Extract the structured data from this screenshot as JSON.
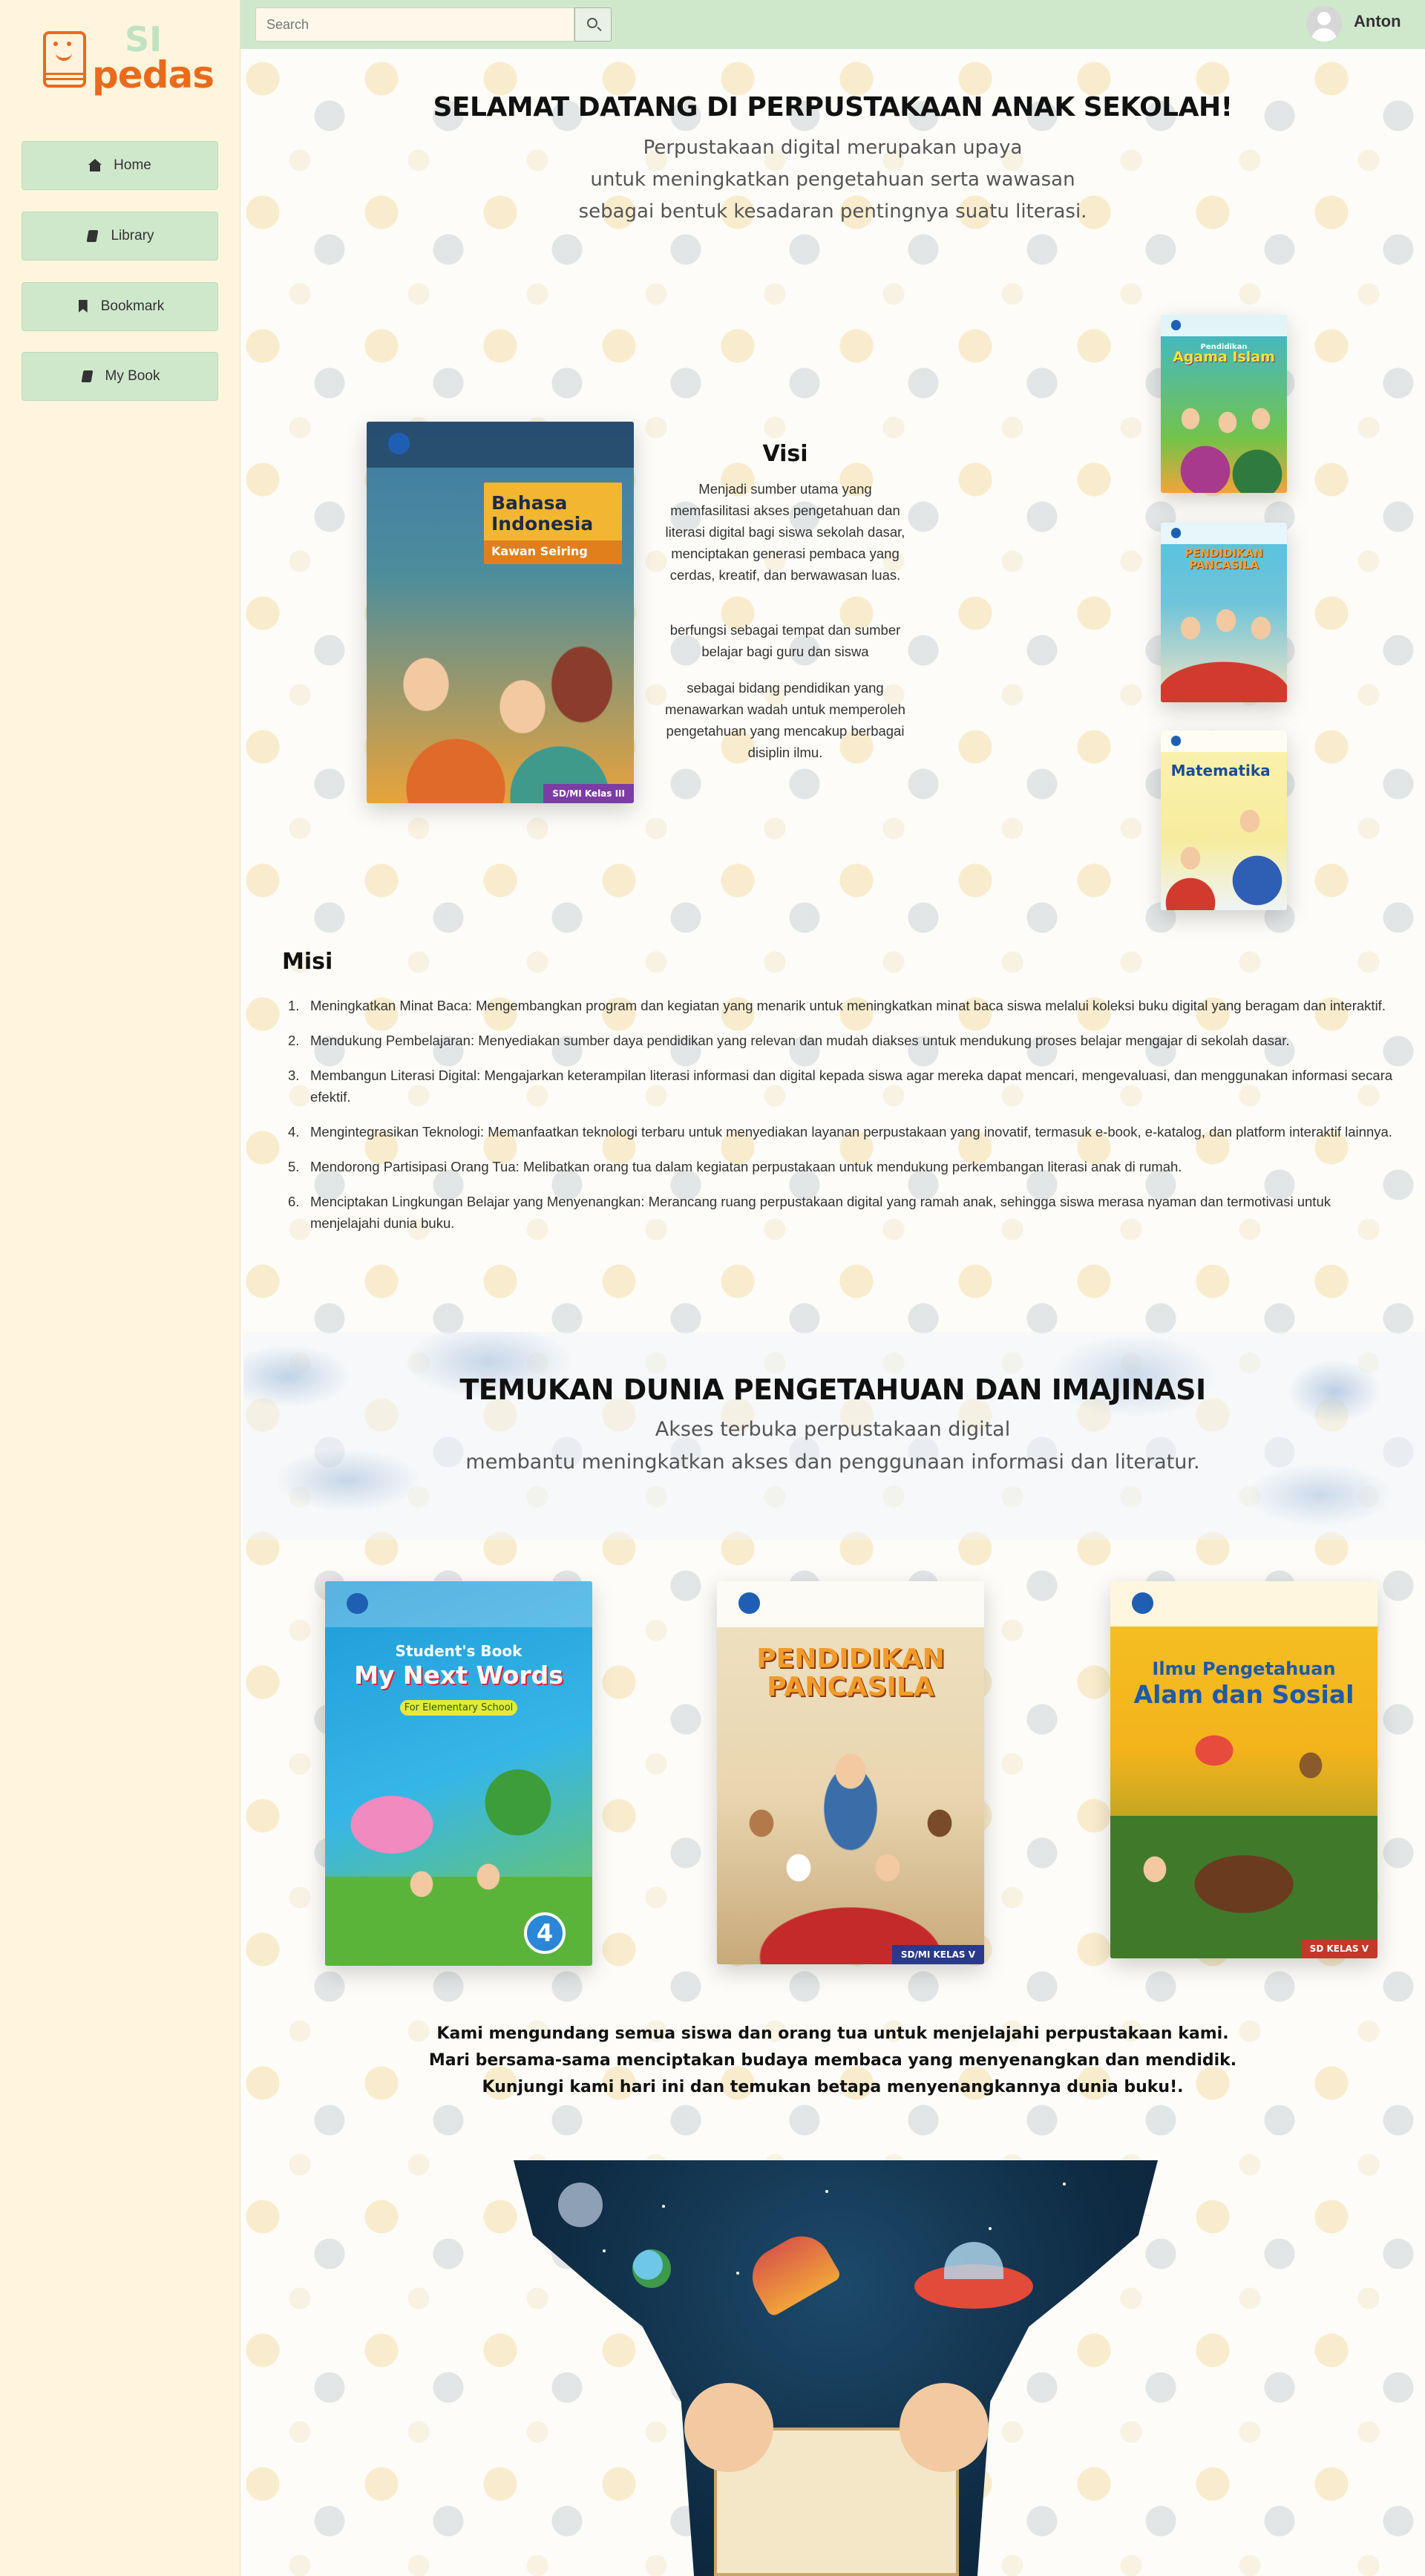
{
  "brand": {
    "logo_top": "SI",
    "logo_bottom": "pedas"
  },
  "sidebar": {
    "items": [
      {
        "label": "Home",
        "icon": "home-icon"
      },
      {
        "label": "Library",
        "icon": "book-icon"
      },
      {
        "label": "Bookmark",
        "icon": "bookmark-icon"
      },
      {
        "label": "My Book",
        "icon": "book-icon"
      }
    ]
  },
  "topbar": {
    "search_placeholder": "Search",
    "search_icon": "search-icon",
    "username": "Anton"
  },
  "hero": {
    "title": "SELAMAT DATANG DI PERPUSTAKAAN ANAK SEKOLAH!",
    "lines": [
      "Perpustakaan digital merupakan upaya",
      "untuk meningkatkan pengetahuan serta wawasan",
      "sebagai bentuk kesadaran pentingnya suatu literasi."
    ]
  },
  "visi": {
    "title": "Visi",
    "paragraphs": [
      "Menjadi sumber utama yang memfasilitasi akses pengetahuan dan literasi digital bagi siswa sekolah dasar, menciptakan generasi pembaca yang cerdas, kreatif, dan berwawasan luas.",
      "berfungsi sebagai tempat dan sumber belajar bagi guru dan siswa",
      "sebagai bidang pendidikan yang menawarkan wadah untuk memperoleh pengetahuan yang mencakup berbagai disiplin ilmu."
    ]
  },
  "featured_book": {
    "title": "Bahasa Indonesia",
    "subtitle": "Kawan Seiring",
    "grade": "SD/MI Kelas III"
  },
  "side_books": [
    {
      "title": "Agama Islam",
      "subtitle": "Pendidikan"
    },
    {
      "title": "PENDIDIKAN PANCASILA",
      "subtitle": ""
    },
    {
      "title": "Matematika",
      "subtitle": ""
    }
  ],
  "misi": {
    "title": "Misi",
    "items": [
      "Meningkatkan Minat Baca: Mengembangkan program dan kegiatan yang menarik untuk meningkatkan minat baca siswa melalui koleksi buku digital yang beragam dan interaktif.",
      "Mendukung Pembelajaran: Menyediakan sumber daya pendidikan yang relevan dan mudah diakses untuk mendukung proses belajar mengajar di sekolah dasar.",
      "Membangun Literasi Digital: Mengajarkan keterampilan literasi informasi dan digital kepada siswa agar mereka dapat mencari, mengevaluasi, dan menggunakan informasi secara efektif.",
      "Mengintegrasikan Teknologi: Memanfaatkan teknologi terbaru untuk menyediakan layanan perpustakaan yang inovatif, termasuk e-book, e-katalog, dan platform interaktif lainnya.",
      "Mendorong Partisipasi Orang Tua: Melibatkan orang tua dalam kegiatan perpustakaan untuk mendukung perkembangan literasi anak di rumah.",
      "Menciptakan Lingkungan Belajar yang Menyenangkan: Merancang ruang perpustakaan digital yang ramah anak, sehingga siswa merasa nyaman dan termotivasi untuk menjelajahi dunia buku."
    ]
  },
  "section2": {
    "title": "TEMUKAN DUNIA PENGETAHUAN DAN IMAJINASI",
    "lines": [
      "Akses terbuka perpustakaan digital",
      "membantu meningkatkan akses dan penggunaan informasi dan literatur."
    ],
    "books": [
      {
        "top": "Student's Book",
        "title": "My Next Words",
        "badge": "For Elementary School",
        "number": "4"
      },
      {
        "top": "",
        "title": "PENDIDIKAN PANCASILA",
        "badge": "SD/MI KELAS V",
        "number": ""
      },
      {
        "top": "Ilmu Pengetahuan",
        "title": "Alam dan Sosial",
        "badge": "SD KELAS V",
        "number": ""
      }
    ]
  },
  "invite": {
    "lines": [
      "Kami mengundang semua siswa dan orang tua untuk menjelajahi perpustakaan kami.",
      "Mari bersama-sama menciptakan budaya membaca yang menyenangkan dan mendidik.",
      "Kunjungi kami hari ini dan temukan betapa menyenangkannya dunia buku!."
    ]
  },
  "colors": {
    "sidebar_bg": "#fff5dc",
    "accent_green": "#cfe8cc",
    "brand_orange": "#ea6a1c"
  }
}
